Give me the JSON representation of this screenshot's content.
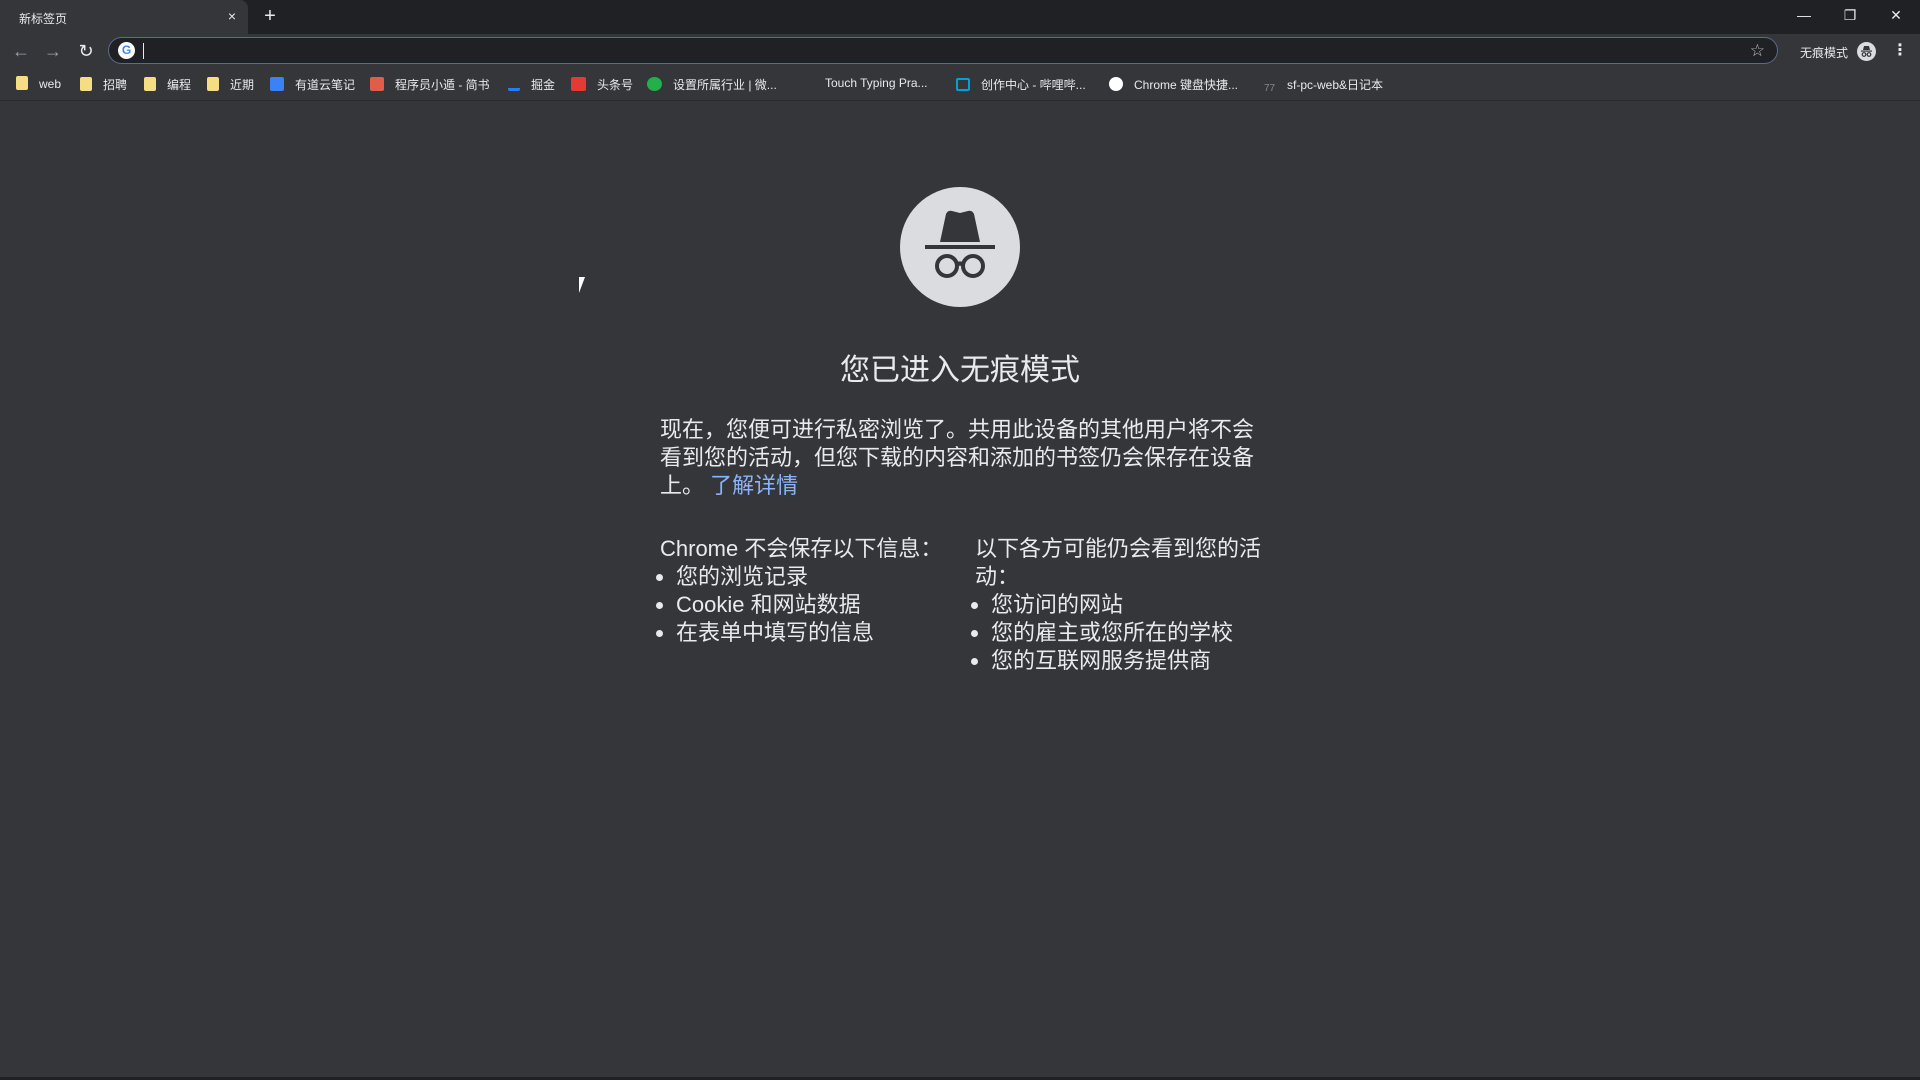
{
  "browser": {
    "tab": {
      "title": "新标签页",
      "close_icon": "×"
    },
    "new_tab_icon": "+",
    "window_controls": {
      "minimize": "—",
      "restore": "❐",
      "close": "✕"
    },
    "nav": {
      "back_icon": "←",
      "forward_icon": "→",
      "reload_icon": "↻"
    },
    "omnibox": {
      "value": "",
      "placeholder": "",
      "engine_icon": "G"
    },
    "bookmark_star_icon": "☆",
    "profile_label": "无痕模式",
    "menu_icon": "⋮"
  },
  "bookmarks": [
    {
      "label": "web",
      "icon": "folder-icon",
      "color": "#f6dc83"
    },
    {
      "label": "招聘",
      "icon": "folder-icon",
      "color": "#f6dc83"
    },
    {
      "label": "编程",
      "icon": "folder-icon",
      "color": "#f6dc83"
    },
    {
      "label": "近期",
      "icon": "folder-icon",
      "color": "#f6dc83"
    },
    {
      "label": "有道云笔记",
      "icon": "youdao-note-icon",
      "color": "#3b82f6"
    },
    {
      "label": "程序员小遁 - 简书",
      "icon": "jianshu-icon",
      "color": "#e05d4b"
    },
    {
      "label": "掘金",
      "icon": "juejin-icon",
      "color": "#1e80ff"
    },
    {
      "label": "头条号",
      "icon": "toutiao-icon",
      "color": "#e53935"
    },
    {
      "label": "设置所属行业 | 微...",
      "icon": "wechat-icon",
      "color": "#22b04a"
    },
    {
      "label": "Touch Typing Pra...",
      "icon": "none",
      "color": ""
    },
    {
      "label": "创作中心 - 哔哩哔...",
      "icon": "bilibili-icon",
      "color": "#00a1d6"
    },
    {
      "label": "Chrome 键盘快捷...",
      "icon": "google-icon",
      "color": "#ffffff"
    },
    {
      "label": "sf-pc-web&日记本",
      "icon": "sf-icon",
      "color": "#555555"
    }
  ],
  "incognito": {
    "title": "您已进入无痕模式",
    "description": "现在，您便可进行私密浏览了。共用此设备的其他用户将不会看到您的活动，但您下载的内容和添加的书签仍会保存在设备上。",
    "learn_more": "了解详情",
    "not_saved": {
      "heading": "Chrome 不会保存以下信息：",
      "items": [
        "您的浏览记录",
        "Cookie 和网站数据",
        "在表单中填写的信息"
      ]
    },
    "may_be_visible": {
      "heading": "以下各方可能仍会看到您的活动：",
      "items": [
        "您访问的网站",
        "您的雇主或您所在的学校",
        "您的互联网服务提供商"
      ]
    }
  },
  "colors": {
    "background": "#35363a",
    "tabstrip": "#202124",
    "text": "#e8eaed",
    "link": "#8ab4f8",
    "logo_circle": "#dadce0"
  }
}
